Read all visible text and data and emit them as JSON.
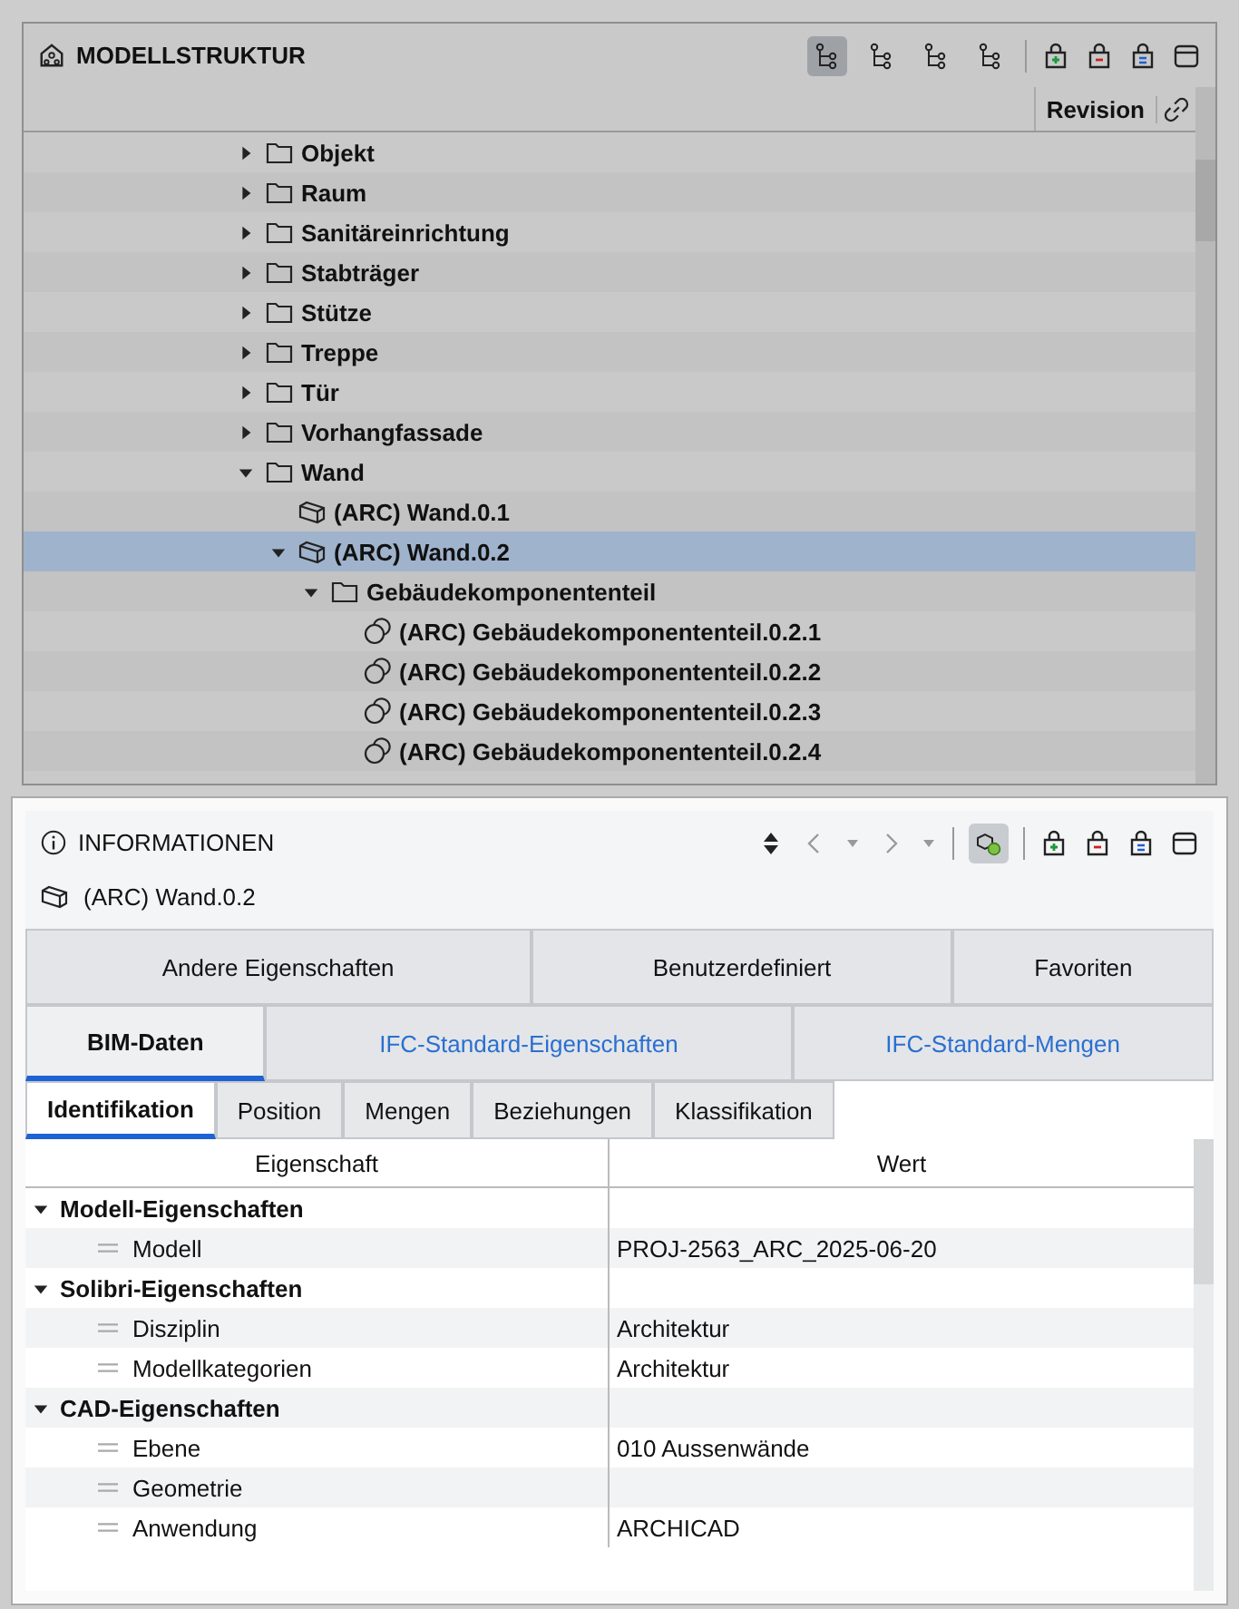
{
  "structure": {
    "title": "MODELLSTRUKTUR",
    "toolbar": [
      {
        "selected": true
      },
      {
        "selected": false
      },
      {
        "selected": false
      },
      {
        "selected": false
      }
    ],
    "columns": [
      "Revision"
    ],
    "tree": [
      {
        "label": "Objekt",
        "kind": "folder",
        "expanded": false,
        "selected": false
      },
      {
        "label": "Raum",
        "kind": "folder",
        "expanded": false,
        "selected": false
      },
      {
        "label": "Sanitäreinrichtung",
        "kind": "folder",
        "expanded": false,
        "selected": false
      },
      {
        "label": "Stabträger",
        "kind": "folder",
        "expanded": false,
        "selected": false
      },
      {
        "label": "Stütze",
        "kind": "folder",
        "expanded": false,
        "selected": false
      },
      {
        "label": "Treppe",
        "kind": "folder",
        "expanded": false,
        "selected": false
      },
      {
        "label": "Tür",
        "kind": "folder",
        "expanded": false,
        "selected": false
      },
      {
        "label": "Vorhangfassade",
        "kind": "folder",
        "expanded": false,
        "selected": false
      },
      {
        "label": "Wand",
        "kind": "folder",
        "expanded": true,
        "selected": false,
        "children": [
          {
            "label": "(ARC) Wand.0.1",
            "kind": "wall",
            "selected": false
          },
          {
            "label": "(ARC) Wand.0.2",
            "kind": "wall",
            "expanded": true,
            "selected": true,
            "children": [
              {
                "label": "Gebäudekomponententeil",
                "kind": "folder",
                "expanded": true,
                "selected": false,
                "children": [
                  {
                    "label": "(ARC) Gebäudekomponententeil.0.2.1",
                    "kind": "part",
                    "selected": false
                  },
                  {
                    "label": "(ARC) Gebäudekomponententeil.0.2.2",
                    "kind": "part",
                    "selected": false
                  },
                  {
                    "label": "(ARC) Gebäudekomponententeil.0.2.3",
                    "kind": "part",
                    "selected": false
                  },
                  {
                    "label": "(ARC) Gebäudekomponententeil.0.2.4",
                    "kind": "part",
                    "selected": false
                  }
                ]
              }
            ]
          }
        ]
      }
    ]
  },
  "information": {
    "title": "INFORMATIONEN",
    "toolbar": [
      {
        "selected": true
      }
    ],
    "object": "(ARC) Wand.0.2",
    "tab_rows": [
      [
        {
          "label": "Andere Eigenschaften",
          "selected": false
        },
        {
          "label": "Benutzerdefiniert",
          "selected": false
        },
        {
          "label": "Favoriten",
          "selected": false
        }
      ],
      [
        {
          "label": "BIM-Daten",
          "selected": true
        },
        {
          "label": "IFC-Standard-Eigenschaften",
          "selected": false
        },
        {
          "label": "IFC-Standard-Mengen",
          "selected": false
        }
      ]
    ],
    "subtabs": [
      {
        "label": "Identifikation",
        "selected": true
      },
      {
        "label": "Position",
        "selected": false
      },
      {
        "label": "Mengen",
        "selected": false
      },
      {
        "label": "Beziehungen",
        "selected": false
      },
      {
        "label": "Klassifikation",
        "selected": false
      }
    ],
    "columns": [
      "Eigenschaft",
      "Wert"
    ],
    "groups": [
      {
        "name": "Modell-Eigenschaften",
        "expanded": true,
        "properties": [
          {
            "name": "Modell",
            "value": "PROJ-2563_ARC_2025-06-20"
          }
        ]
      },
      {
        "name": "Solibri-Eigenschaften",
        "expanded": true,
        "properties": [
          {
            "name": "Disziplin",
            "value": "Architektur"
          },
          {
            "name": "Modellkategorien",
            "value": "Architektur"
          }
        ]
      },
      {
        "name": "CAD-Eigenschaften",
        "expanded": true,
        "properties": [
          {
            "name": "Ebene",
            "value": "010 Aussenwände"
          },
          {
            "name": "Geometrie"
          },
          {
            "name": "Anwendung",
            "value": "ARCHICAD"
          }
        ]
      }
    ]
  }
}
